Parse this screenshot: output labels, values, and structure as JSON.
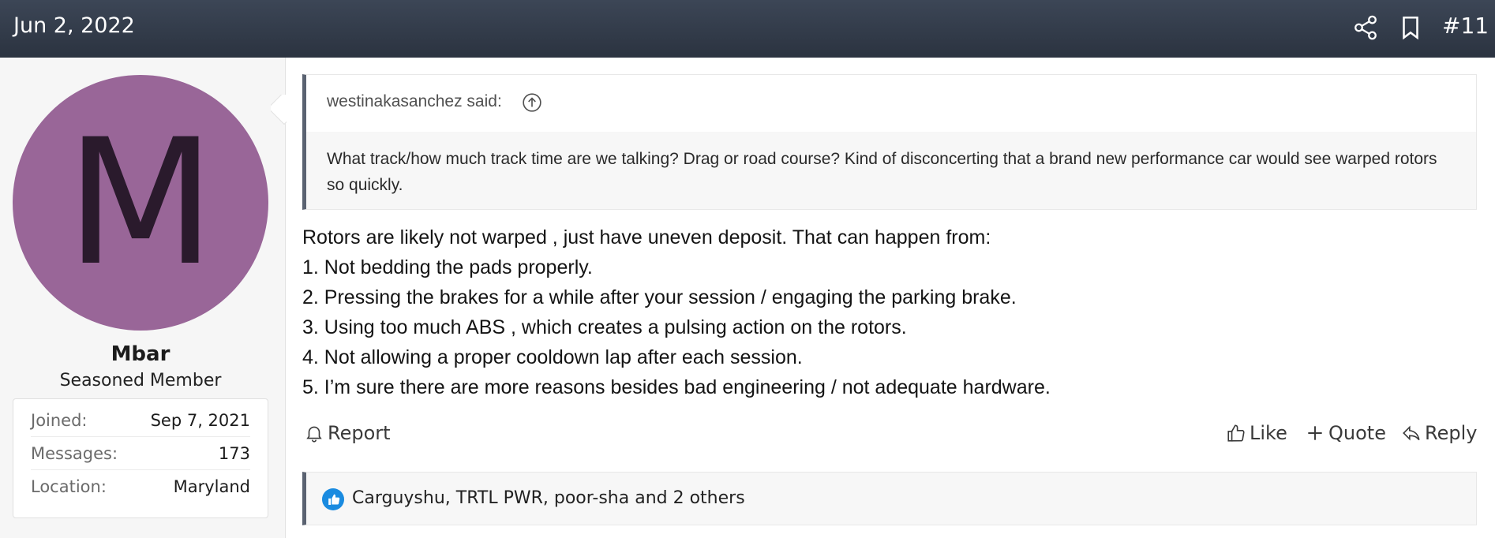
{
  "header": {
    "date": "Jun 2, 2022",
    "post_number": "#11",
    "icons": [
      "share-icon",
      "bookmark-icon"
    ]
  },
  "user": {
    "avatar_letter": "M",
    "avatar_color": "#996698",
    "name": "Mbar",
    "title": "Seasoned Member",
    "stats": [
      {
        "label": "Joined:",
        "value": "Sep 7, 2021"
      },
      {
        "label": "Messages:",
        "value": "173"
      },
      {
        "label": "Location:",
        "value": "Maryland"
      }
    ]
  },
  "quote": {
    "author": "westinakasanchez said:",
    "text": "What track/how much track time are we talking? Drag or road course? Kind of disconcerting that a brand new performance car would see warped rotors so quickly."
  },
  "message": {
    "lines": [
      "Rotors are likely not warped , just have uneven deposit. That can happen from:",
      "1. Not bedding the pads properly.",
      "2. Pressing the brakes for a while after your session / engaging the parking brake.",
      "3. Using too much ABS , which creates a pulsing action on the rotors.",
      "4. Not allowing a proper cooldown lap after each session.",
      "5. I’m sure there are more reasons besides bad engineering / not adequate hardware."
    ]
  },
  "actions": {
    "report": "Report",
    "like": "Like",
    "quote": "Quote",
    "reply": "Reply"
  },
  "reactions": {
    "text": "Carguyshu, TRTL PWR, poor-sha and 2 others",
    "icon_color": "#1a8be0"
  }
}
